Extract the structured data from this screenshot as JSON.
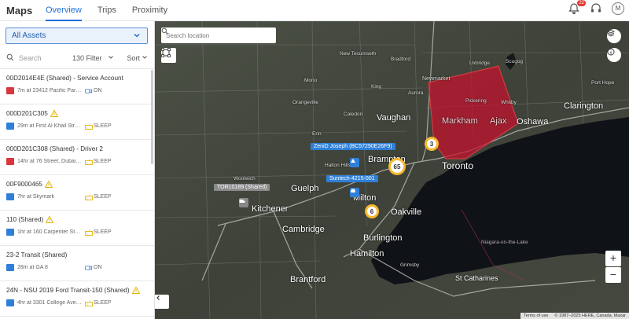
{
  "header": {
    "app_title": "Maps",
    "tabs": [
      {
        "label": "Overview",
        "active": true
      },
      {
        "label": "Trips",
        "active": false
      },
      {
        "label": "Proximity",
        "active": false
      }
    ],
    "notification_count": "22",
    "avatar_initial": "M"
  },
  "sidebar": {
    "asset_filter": "All Assets",
    "search_placeholder": "Search",
    "count": "130",
    "filter_label": "Filter",
    "sort_label": "Sort",
    "assets": [
      {
        "name": "00D2014E4E (Shared) - Service Account",
        "warning": false,
        "icon_color": "red",
        "location": "7m at 23412 Pacific Park Dr...",
        "status": "ON",
        "status_icon": "camera-icon"
      },
      {
        "name": "000D201C305",
        "warning": true,
        "icon_color": "blue",
        "location": "29m at First Al Khail Street",
        "status": "SLEEP",
        "status_icon": "sleep-icon"
      },
      {
        "name": "000D201C308 (Shared) - Driver 2",
        "warning": false,
        "icon_color": "red",
        "location": "14hr at 76 Street, Dubai Inve...",
        "status": "SLEEP",
        "status_icon": "sleep-icon"
      },
      {
        "name": "00F9000465",
        "warning": true,
        "icon_color": "blue",
        "location": "7hr at Skymark",
        "status": "SLEEP",
        "status_icon": "sleep-icon"
      },
      {
        "name": "110 (Shared)",
        "warning": true,
        "icon_color": "blue",
        "location": "1hr at 160 Carpenter St, Pro...",
        "status": "SLEEP",
        "status_icon": "sleep-icon"
      },
      {
        "name": "23-2 Transit (Shared)",
        "warning": false,
        "icon_color": "blue",
        "location": "28m at GA 8",
        "status": "ON",
        "status_icon": "camera-icon"
      },
      {
        "name": "24N - NSU 2019 Ford Transit-150 (Shared)",
        "warning": true,
        "icon_color": "blue",
        "location": "4hr at 3301 College Ave, Da...",
        "status": "SLEEP",
        "status_icon": "sleep-icon"
      }
    ]
  },
  "map": {
    "search_placeholder": "Search location",
    "cities": {
      "toronto": "Toronto",
      "vaughan": "Vaughan",
      "brampton": "Brampton",
      "markham": "Markham",
      "ajax": "Ajax",
      "oshawa": "Oshawa",
      "guelph": "Guelph",
      "kitchener": "Kitchener",
      "cambridge": "Cambridge",
      "oakville": "Oakville",
      "burlington": "Burlington",
      "hamilton": "Hamilton",
      "brantford": "Brantford",
      "clarington": "Clarington",
      "newmarket": "Newmarket",
      "st_catharines": "St Catharines",
      "milton": "Milton"
    },
    "towns": {
      "orangeville": "Orangeville",
      "new_tecumseth": "New Tecumseth",
      "bradford": "Bradford",
      "uxbridge": "Uxbridge",
      "scugog": "Scugog",
      "woolwich": "Woolwich",
      "halton_hills": "Halton Hills",
      "grimsby": "Grimsby",
      "niagara": "Niagara-on-the-Lake",
      "aurora": "Aurora",
      "king": "King",
      "caledon": "Caledon",
      "mono": "Mono",
      "erin": "Erin",
      "whitby": "Whitby",
      "pickering": "Pickering",
      "port_hope": "Port Hope"
    },
    "vehicles": [
      {
        "label": "ZeniD Joseph (BC57290E26F9)",
        "style": "blue"
      },
      {
        "label": "Suntech-4215-001",
        "style": "blue"
      },
      {
        "label": "TOR10189 (Shared)",
        "style": "gray"
      }
    ],
    "clusters": [
      "3",
      "65",
      "6"
    ],
    "zoom_in": "+",
    "zoom_out": "−",
    "attribution": {
      "terms": "Terms of use",
      "copyright": "© 1987–2025 HERE, Canada, Maxar"
    },
    "geofence_color": "#c8102e"
  }
}
